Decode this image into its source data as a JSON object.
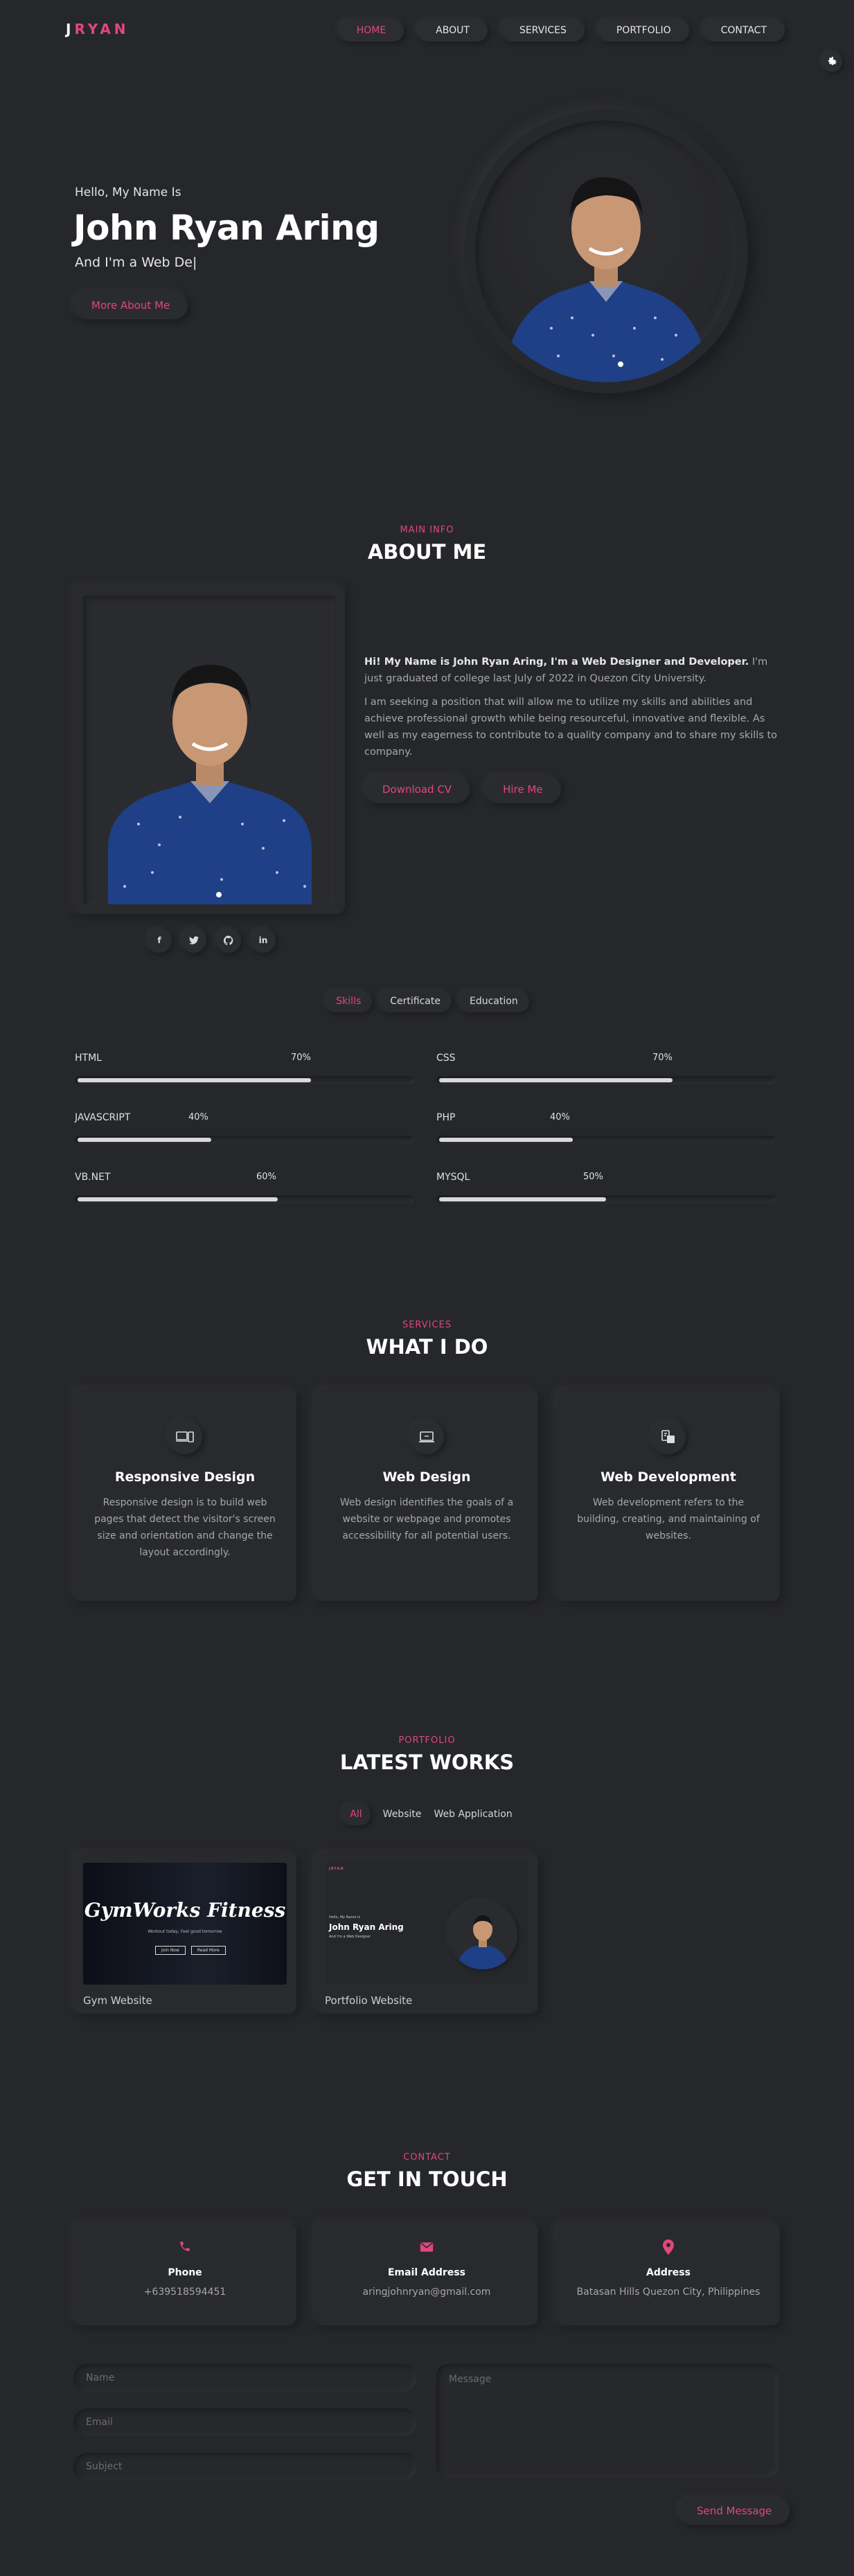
{
  "header": {
    "logo_first": "J",
    "logo_rest": "RYAN",
    "nav": [
      "HOME",
      "ABOUT",
      "SERVICES",
      "PORTFOLIO",
      "CONTACT"
    ],
    "gear_icon": "gear-icon"
  },
  "hero": {
    "greeting": "Hello, My Name Is",
    "name": "John Ryan Aring",
    "role": "And I'm a Web De|",
    "cta": "More About Me"
  },
  "about": {
    "eyebrow": "MAIN INFO",
    "title": "ABOUT ME",
    "intro_bold": "Hi! My Name is John Ryan Aring, I'm a Web Designer and Developer.",
    "intro_rest": "I'm just graduated of college last July of 2022 in Quezon City University.",
    "paragraph2": "I am seeking a position that will allow me to utilize my skills and abilities and achieve professional growth while being resourceful, innovative and flexible. As well as my eagerness to contribute to a quality company and to share my skills to company.",
    "btn_cv": "Download CV",
    "btn_hire": "Hire Me",
    "social": [
      "f",
      "🐦",
      "◐",
      "in"
    ]
  },
  "tabs": [
    "Skills",
    "Certificate",
    "Education"
  ],
  "skills": [
    {
      "name": "HTML",
      "pct": "70%",
      "value": 0.7
    },
    {
      "name": "CSS",
      "pct": "70%",
      "value": 0.7
    },
    {
      "name": "JAVASCRIPT",
      "pct": "40%",
      "value": 0.4
    },
    {
      "name": "PHP",
      "pct": "40%",
      "value": 0.4
    },
    {
      "name": "VB.NET",
      "pct": "60%",
      "value": 0.6
    },
    {
      "name": "MYSQL",
      "pct": "50%",
      "value": 0.5
    }
  ],
  "services": {
    "eyebrow": "SERVICES",
    "title": "WHAT I DO",
    "items": [
      {
        "title": "Responsive Design",
        "text": "Responsive design is to build web pages that detect the visitor's screen size and orientation and change the layout accordingly.",
        "icon": "devices-icon"
      },
      {
        "title": "Web Design",
        "text": "Web design identifies the goals of a website or webpage and promotes accessibility for all potential users.",
        "icon": "laptop-icon"
      },
      {
        "title": "Web Development",
        "text": "Web development refers to the building, creating, and maintaining of websites.",
        "icon": "server-icon"
      }
    ]
  },
  "portfolio": {
    "eyebrow": "PORTFOLIO",
    "title": "LATEST WORKS",
    "filters": [
      "All",
      "Website",
      "Web Application"
    ],
    "items": [
      {
        "caption": "Gym Website",
        "thumb_title": "GymWorks Fitness",
        "thumb_sub": "Workout today, Feel good tomorrow",
        "thumb_b1": "Join Now",
        "thumb_b2": "Read More"
      },
      {
        "caption": "Portfolio Website",
        "thumb_hello": "Hello, My Name Is",
        "thumb_name": "John Ryan Aring",
        "thumb_role": "And I'm a Web Designer",
        "thumb_logo": "JRYAN"
      }
    ]
  },
  "contact": {
    "eyebrow": "CONTACT",
    "title": "GET IN TOUCH",
    "cards": [
      {
        "label": "Phone",
        "value": "+639518594451",
        "icon": "phone-icon"
      },
      {
        "label": "Email Address",
        "value": "aringjohnryan@gmail.com",
        "icon": "envelope-icon"
      },
      {
        "label": "Address",
        "value": "Batasan Hills Quezon City, Philippines",
        "icon": "map-pin-icon"
      }
    ],
    "placeholders": {
      "name": "Name",
      "email": "Email",
      "subject": "Subject",
      "message": "Message"
    },
    "send": "Send Message"
  },
  "colors": {
    "accent": "#e2477a",
    "background": "#26272b"
  }
}
